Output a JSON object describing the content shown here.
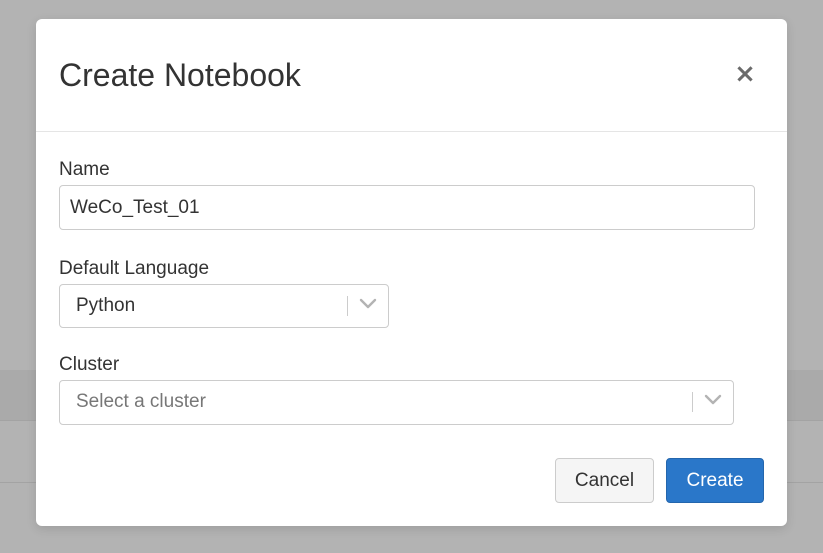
{
  "dialog": {
    "title": "Create Notebook",
    "close_symbol": "×"
  },
  "fields": {
    "name": {
      "label": "Name",
      "value": "WeCo_Test_01"
    },
    "default_language": {
      "label": "Default Language",
      "selected": "Python"
    },
    "cluster": {
      "label": "Cluster",
      "placeholder": "Select a cluster"
    }
  },
  "actions": {
    "cancel_label": "Cancel",
    "create_label": "Create"
  },
  "icons": {
    "close": "close-icon",
    "dropdown": "chevron-down-icon"
  },
  "colors": {
    "primary": "#2a77c9",
    "overlay": "#b3b3b3"
  }
}
